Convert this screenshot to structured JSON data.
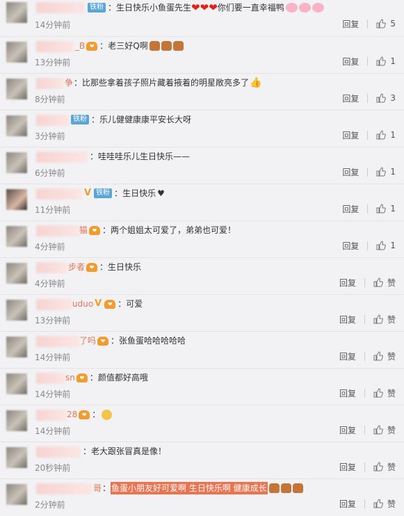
{
  "comments": [
    {
      "name_tail": "",
      "fan_badge": "铁粉",
      "sep": "：",
      "content": "生日快乐小鱼蛋先生",
      "content_after": "你们要一直幸福鸭",
      "time": "14分钟前",
      "reply": "回复",
      "likes": "5",
      "avatar_colors": [
        "#9a9a9a",
        "#e0e0e0"
      ]
    },
    {
      "name_tail": "_B",
      "fan_badge": "",
      "sep": "：",
      "content": "老三好Q啊",
      "time": "13分钟前",
      "reply": "回复",
      "likes": "1"
    },
    {
      "name_tail": "争",
      "fan_badge": "",
      "sep": "：",
      "content": "比那些拿着孩子照片藏着掖着的明星敞亮多了",
      "time": "8分钟前",
      "reply": "回复",
      "likes": "3"
    },
    {
      "name_tail": "",
      "fan_badge": "铁粉",
      "sep": "：",
      "content": "乐儿健健康康平安长大呀",
      "time": "3分钟前",
      "reply": "回复",
      "likes": "1"
    },
    {
      "name_tail": "",
      "fan_badge": "",
      "sep": "：",
      "content": "哇哇哇乐儿生日快乐——",
      "time": "6分钟前",
      "reply": "回复",
      "likes": "1"
    },
    {
      "name_tail": "",
      "fan_badge": "铁粉",
      "sep": "：",
      "content": "生日快乐",
      "time": "11分钟前",
      "reply": "回复",
      "likes": "1"
    },
    {
      "name_tail": "猫",
      "fan_badge": "",
      "sep": "：",
      "content": "两个姐姐太可爱了，弟弟也可爱！",
      "time": "4分钟前",
      "reply": "回复",
      "likes": "1"
    },
    {
      "name_tail": "步者",
      "fan_badge": "",
      "sep": "：",
      "content": "生日快乐",
      "time": "4分钟前",
      "reply": "回复",
      "likes": "赞"
    },
    {
      "name_tail": "uduo",
      "fan_badge": "",
      "sep": "：",
      "content": "可爱",
      "time": "13分钟前",
      "reply": "回复",
      "likes": "赞"
    },
    {
      "name_tail": "了吗",
      "fan_badge": "",
      "sep": "：",
      "content": "张鱼蛋哈哈哈哈哈",
      "time": "14分钟前",
      "reply": "回复",
      "likes": "赞"
    },
    {
      "name_tail": "sn",
      "fan_badge": "",
      "sep": "：",
      "content": "颜值都好高哦",
      "time": "14分钟前",
      "reply": "回复",
      "likes": "赞"
    },
    {
      "name_tail": "28",
      "fan_badge": "",
      "sep": "：",
      "content": "",
      "time": "14分钟前",
      "reply": "回复",
      "likes": "赞"
    },
    {
      "name_tail": "",
      "fan_badge": "",
      "sep": "：",
      "content": "老大跟张冒真是像！",
      "time": "20秒钟前",
      "reply": "回复",
      "likes": "赞"
    },
    {
      "name_tail": "哥",
      "fan_badge": "",
      "sep": "：",
      "content": "鱼蛋小朋友好可爱啊 生日快乐啊 健康成长",
      "time": "2分钟前",
      "reply": "回复",
      "likes": "赞"
    }
  ],
  "colors": {
    "accent": "#eb7350",
    "fan_badge": "#59a5d8",
    "time": "#888888"
  },
  "icons": [
    "like-icon",
    "vip-badge-icon",
    "verified-v-icon",
    "heart-emoji",
    "pig-emoji",
    "cake-emoji",
    "smile-hearts-emoji",
    "thumbs-up-emoji"
  ]
}
